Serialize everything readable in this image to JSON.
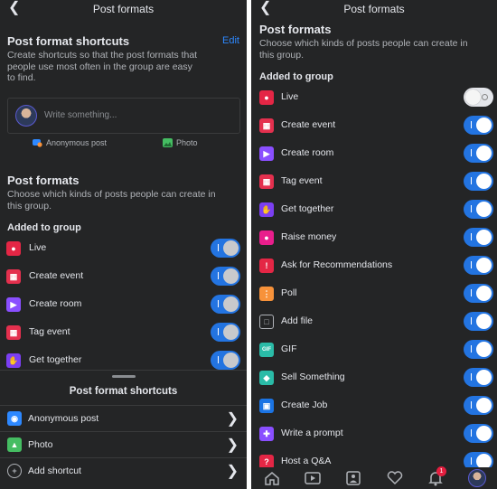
{
  "left": {
    "title": "Post formats",
    "shortcuts": {
      "heading": "Post format shortcuts",
      "edit_label": "Edit",
      "description": [
        "Create shortcuts so that the post formats that",
        "people use most often in the group are easy",
        "to find."
      ],
      "composer_placeholder": "Write something...",
      "options": [
        "Anonymous post",
        "Photo"
      ]
    },
    "formats": {
      "heading": "Post formats",
      "description": [
        "Choose which kinds of posts people can create in",
        "this group."
      ],
      "subheading": "Added to group",
      "items": [
        {
          "label": "Live",
          "icon": "live-video-icon",
          "color": "#e42645",
          "enabled": true
        },
        {
          "label": "Create event",
          "icon": "calendar-icon",
          "color": "#e4304e",
          "enabled": true
        },
        {
          "label": "Create room",
          "icon": "video-room-icon",
          "color": "#8a4fff",
          "enabled": true
        },
        {
          "label": "Tag event",
          "icon": "calendar-tag-icon",
          "color": "#e4304e",
          "enabled": true
        },
        {
          "label": "Get together",
          "icon": "waving-hand-icon",
          "color": "#7b3ff2",
          "enabled": true
        }
      ]
    },
    "sheet": {
      "title": "Post format shortcuts",
      "items": [
        {
          "label": "Anonymous post",
          "icon": "anonymous-chat-icon",
          "color": "#2d88ff"
        },
        {
          "label": "Photo",
          "icon": "photo-icon",
          "color": "#45bd62"
        },
        {
          "label": "Add shortcut",
          "icon": "add-icon",
          "color": "#b0b3b8"
        }
      ]
    }
  },
  "right": {
    "title": "Post formats",
    "heading": "Post formats",
    "description": [
      "Choose which kinds of posts people can create in",
      "this group."
    ],
    "subheading": "Added to group",
    "items": [
      {
        "label": "Live",
        "icon": "live-video-icon",
        "color": "#e42645",
        "enabled": false
      },
      {
        "label": "Create event",
        "icon": "calendar-icon",
        "color": "#e4304e",
        "enabled": true
      },
      {
        "label": "Create room",
        "icon": "video-room-icon",
        "color": "#8a4fff",
        "enabled": true
      },
      {
        "label": "Tag event",
        "icon": "calendar-tag-icon",
        "color": "#e4304e",
        "enabled": true
      },
      {
        "label": "Get together",
        "icon": "waving-hand-icon",
        "color": "#7b3ff2",
        "enabled": true
      },
      {
        "label": "Raise money",
        "icon": "piggy-bank-icon",
        "color": "#e91e8c",
        "enabled": true
      },
      {
        "label": "Ask for Recommendations",
        "icon": "recommendation-icon",
        "color": "#e42645",
        "enabled": true
      },
      {
        "label": "Poll",
        "icon": "poll-icon",
        "color": "#f7923a",
        "enabled": true
      },
      {
        "label": "Add file",
        "icon": "file-icon",
        "color": "#b0b3b8",
        "enabled": true
      },
      {
        "label": "GIF",
        "icon": "gif-icon",
        "color": "#2abba7",
        "enabled": true
      },
      {
        "label": "Sell Something",
        "icon": "price-tag-icon",
        "color": "#2abba7",
        "enabled": true
      },
      {
        "label": "Create Job",
        "icon": "briefcase-icon",
        "color": "#1b74e4",
        "enabled": true
      },
      {
        "label": "Write a prompt",
        "icon": "prompt-icon",
        "color": "#8a4fff",
        "enabled": true
      },
      {
        "label": "Host a Q&A",
        "icon": "qa-icon",
        "color": "#e42645",
        "enabled": true
      }
    ],
    "nav": [
      {
        "name": "home-icon"
      },
      {
        "name": "video-icon"
      },
      {
        "name": "marketplace-icon"
      },
      {
        "name": "dating-heart-icon"
      },
      {
        "name": "notifications-icon",
        "badge": "1"
      },
      {
        "name": "profile-avatar"
      }
    ]
  }
}
